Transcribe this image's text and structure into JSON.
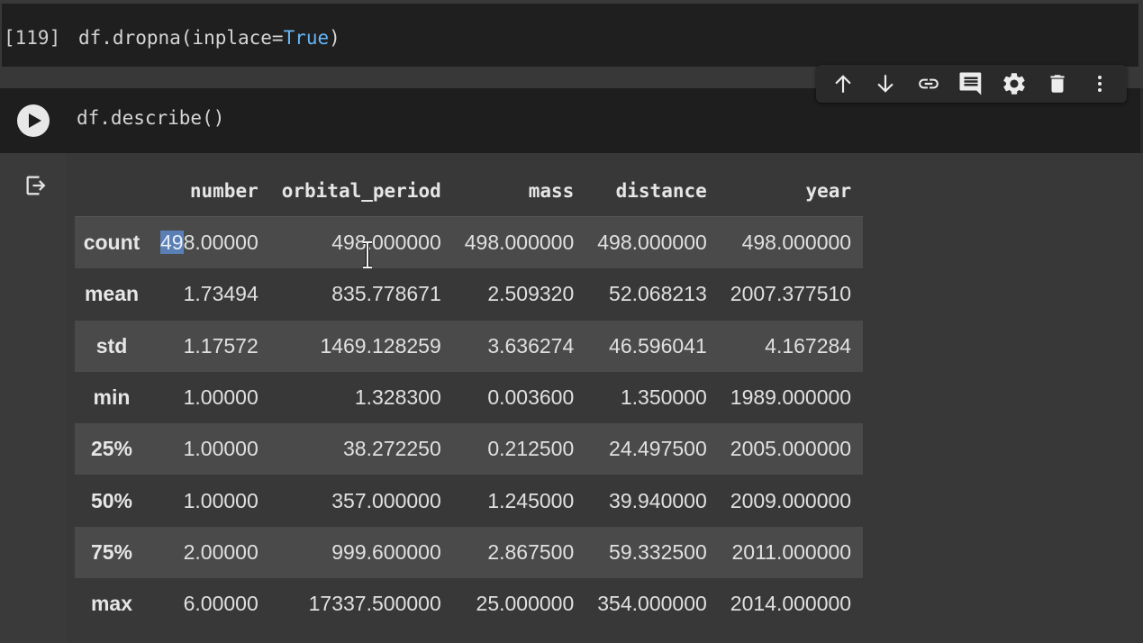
{
  "prev_cell": {
    "exec_count": "[119]",
    "code_prefix": "df.dropna(inplace=",
    "code_keyword": "True",
    "code_suffix": ")"
  },
  "active_cell": {
    "code": "df.describe()"
  },
  "toolbar": {
    "icons": [
      "move-up-icon",
      "move-down-icon",
      "link-icon",
      "comment-icon",
      "gear-icon",
      "trash-icon",
      "more-vert-icon"
    ]
  },
  "describe_table": {
    "columns": [
      "number",
      "orbital_period",
      "mass",
      "distance",
      "year"
    ],
    "rows": [
      {
        "label": "count",
        "values": [
          "498.00000",
          "498.000000",
          "498.000000",
          "498.000000",
          "498.000000"
        ]
      },
      {
        "label": "mean",
        "values": [
          "1.73494",
          "835.778671",
          "2.509320",
          "52.068213",
          "2007.377510"
        ]
      },
      {
        "label": "std",
        "values": [
          "1.17572",
          "1469.128259",
          "3.636274",
          "46.596041",
          "4.167284"
        ]
      },
      {
        "label": "min",
        "values": [
          "1.00000",
          "1.328300",
          "0.003600",
          "1.350000",
          "1989.000000"
        ]
      },
      {
        "label": "25%",
        "values": [
          "1.00000",
          "38.272250",
          "0.212500",
          "24.497500",
          "2005.000000"
        ]
      },
      {
        "label": "50%",
        "values": [
          "1.00000",
          "357.000000",
          "1.245000",
          "39.940000",
          "2009.000000"
        ]
      },
      {
        "label": "75%",
        "values": [
          "2.00000",
          "999.600000",
          "2.867500",
          "59.332500",
          "2011.000000"
        ]
      },
      {
        "label": "max",
        "values": [
          "6.00000",
          "17337.500000",
          "25.000000",
          "354.000000",
          "2014.000000"
        ]
      }
    ],
    "selected_text": "49",
    "selected_rest": "8.00000"
  },
  "colors": {
    "keyword": "#64b5f6",
    "selection": "#5a7fb5",
    "cell_bg": "#1e1e1e",
    "striped_row": "#4a4a4a"
  }
}
